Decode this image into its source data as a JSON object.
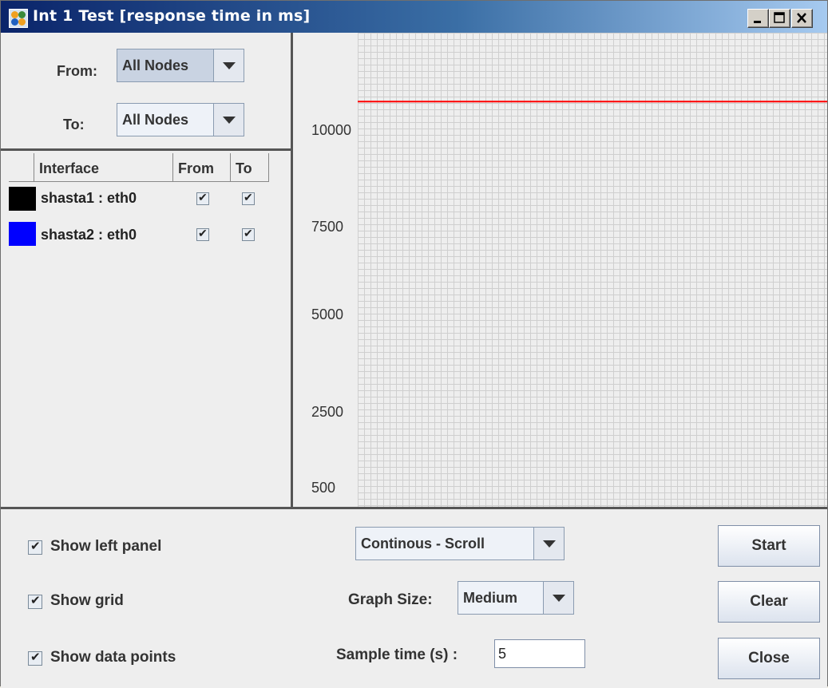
{
  "window": {
    "title": "Int 1 Test [response time in ms]"
  },
  "left_panel": {
    "from_label": "From:",
    "from_value": "All Nodes",
    "to_label": "To:",
    "to_value": "All Nodes",
    "table": {
      "headers": [
        "Interface",
        "From",
        "To"
      ],
      "rows": [
        {
          "color": "#000000",
          "label": "shasta1 : eth0",
          "from": true,
          "to": true
        },
        {
          "color": "#0000ff",
          "label": "shasta2 : eth0",
          "from": true,
          "to": true
        }
      ]
    }
  },
  "graph": {
    "ticks": [
      "10000",
      "7500",
      "5000",
      "2500",
      "500"
    ],
    "threshold_color": "#ff0000",
    "grid_color": "#cfcfcf"
  },
  "chart_data": {
    "type": "line",
    "title": "",
    "xlabel": "",
    "ylabel": "",
    "y_ticks": [
      10000,
      7500,
      5000,
      2500,
      500
    ],
    "ylim": [
      0,
      11700
    ],
    "grid": true,
    "series": [
      {
        "name": "",
        "color": "#ff0000",
        "x": [
          0,
          1
        ],
        "values": [
          10000,
          10000
        ]
      }
    ]
  },
  "options": {
    "show_left_panel": "Show left panel",
    "show_grid": "Show grid",
    "show_data_points": "Show data points"
  },
  "controls": {
    "mode_value": "Continous - Scroll",
    "graph_size_label": "Graph Size:",
    "graph_size_value": "Medium",
    "sample_time_label": "Sample time (s) :",
    "sample_time_value": "5"
  },
  "buttons": {
    "start": "Start",
    "clear": "Clear",
    "close": "Close"
  }
}
